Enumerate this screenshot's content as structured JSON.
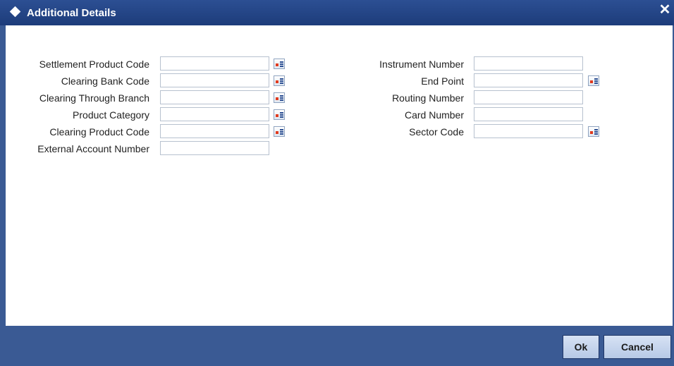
{
  "window": {
    "title": "Additional Details",
    "close_glyph": "✕"
  },
  "left_fields": [
    {
      "label": "Settlement Product Code",
      "value": "",
      "has_lov": true
    },
    {
      "label": "Clearing Bank Code",
      "value": "",
      "has_lov": true
    },
    {
      "label": "Clearing Through Branch",
      "value": "",
      "has_lov": true
    },
    {
      "label": "Product Category",
      "value": "",
      "has_lov": true
    },
    {
      "label": "Clearing Product Code",
      "value": "",
      "has_lov": true
    },
    {
      "label": "External Account Number",
      "value": "",
      "has_lov": false
    }
  ],
  "right_fields": [
    {
      "label": "Instrument Number",
      "value": "",
      "has_lov": false
    },
    {
      "label": "End Point",
      "value": "",
      "has_lov": true
    },
    {
      "label": "Routing Number",
      "value": "",
      "has_lov": false
    },
    {
      "label": "Card Number",
      "value": "",
      "has_lov": false
    },
    {
      "label": "Sector Code",
      "value": "",
      "has_lov": true
    }
  ],
  "footer": {
    "ok_label": "Ok",
    "cancel_label": "Cancel"
  },
  "icons": {
    "lov": "list-of-values-icon",
    "title": "diamond-icon",
    "close": "close-icon"
  },
  "colors": {
    "titlebar": "#2c4f93",
    "footer": "#3a5a94",
    "button": "#c7d6ee"
  }
}
